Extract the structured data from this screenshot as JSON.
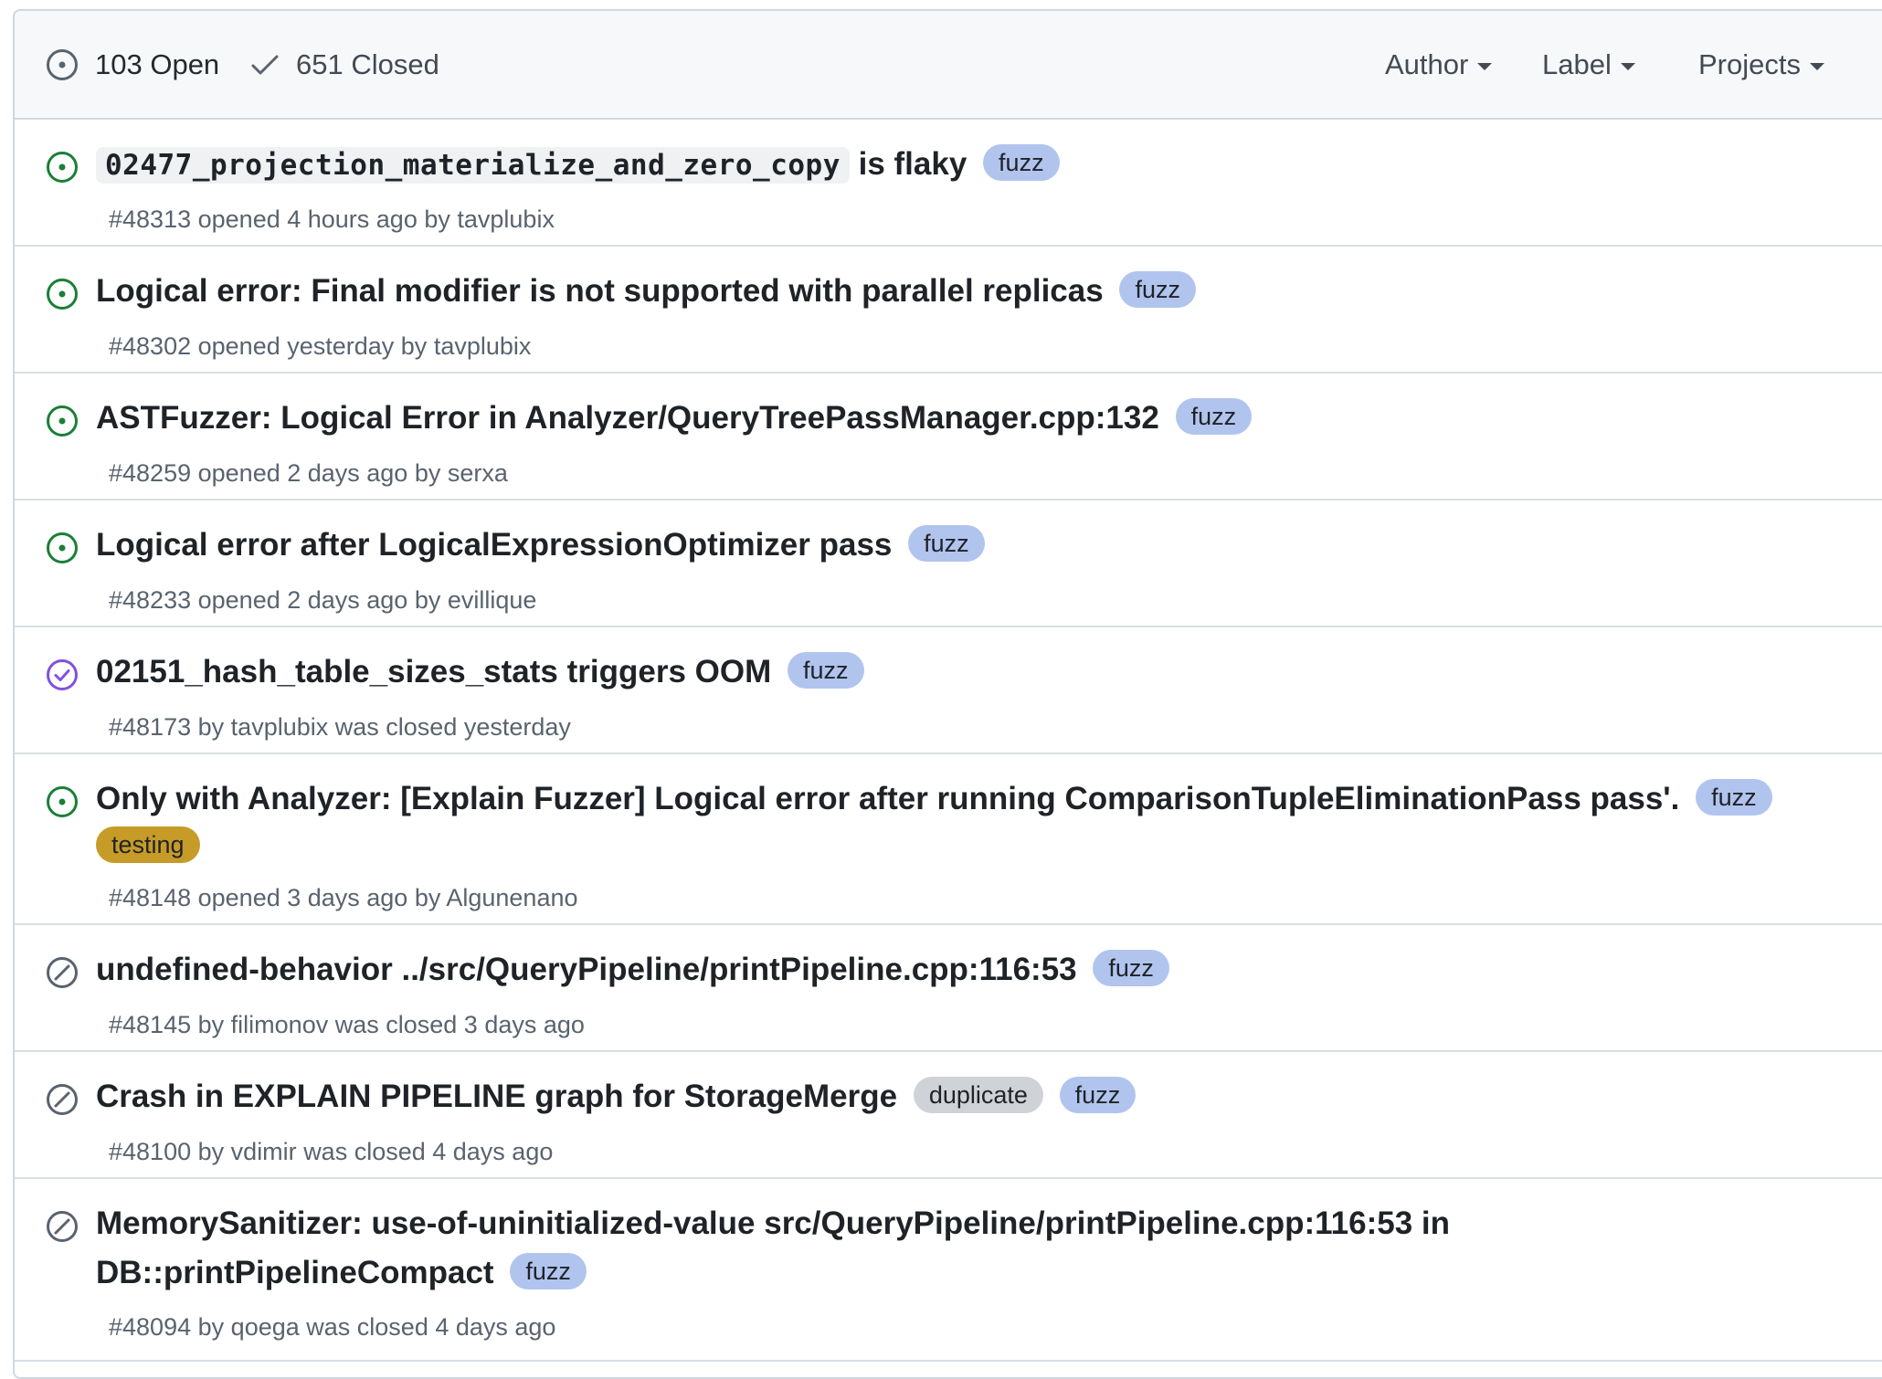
{
  "header": {
    "open_count": "103 Open",
    "closed_count": "651 Closed",
    "filters": {
      "author": "Author",
      "label": "Label",
      "projects": "Projects"
    }
  },
  "colors": {
    "open_icon": "#1a7f37",
    "closed_completed_icon": "#8250df",
    "closed_not_planned_icon": "#59636e",
    "label_fuzz": "#b1c4ee",
    "label_testing": "#c69b28",
    "label_duplicate": "#cfd3d7"
  },
  "issues": [
    {
      "state": "open",
      "icon": "issue-opened-icon",
      "title_code": "02477_projection_materialize_and_zero_copy",
      "title_rest": "is flaky",
      "labels": [
        "fuzz"
      ],
      "number": "#48313",
      "meta": "opened 4 hours ago by",
      "author": "tavplubix"
    },
    {
      "state": "open",
      "icon": "issue-opened-icon",
      "title": "Logical error: Final modifier is not supported with parallel replicas",
      "labels": [
        "fuzz"
      ],
      "number": "#48302",
      "meta": "opened yesterday by",
      "author": "tavplubix"
    },
    {
      "state": "open",
      "icon": "issue-opened-icon",
      "title": "ASTFuzzer: Logical Error in Analyzer/QueryTreePassManager.cpp:132",
      "labels": [
        "fuzz"
      ],
      "number": "#48259",
      "meta": "opened 2 days ago by",
      "author": "serxa"
    },
    {
      "state": "open",
      "icon": "issue-opened-icon",
      "title": "Logical error after LogicalExpressionOptimizer pass",
      "labels": [
        "fuzz"
      ],
      "number": "#48233",
      "meta": "opened 2 days ago by",
      "author": "evillique"
    },
    {
      "state": "closed-completed",
      "icon": "issue-closed-icon",
      "title": "02151_hash_table_sizes_stats triggers OOM",
      "labels": [
        "fuzz"
      ],
      "number": "#48173",
      "meta_prefix": "by",
      "author": "tavplubix",
      "meta_suffix": "was closed yesterday"
    },
    {
      "state": "open",
      "icon": "issue-opened-icon",
      "title": "Only with Analyzer: [Explain Fuzzer] Logical error after running ComparisonTupleEliminationPass pass'.",
      "labels": [
        "fuzz",
        "testing"
      ],
      "number": "#48148",
      "meta": "opened 3 days ago by",
      "author": "Algunenano"
    },
    {
      "state": "closed-not-planned",
      "icon": "skip-icon",
      "title": "undefined-behavior ../src/QueryPipeline/printPipeline.cpp:116:53",
      "labels": [
        "fuzz"
      ],
      "number": "#48145",
      "meta_prefix": "by",
      "author": "filimonov",
      "meta_suffix": "was closed 3 days ago"
    },
    {
      "state": "closed-not-planned",
      "icon": "skip-icon",
      "title": "Crash in EXPLAIN PIPELINE graph for StorageMerge",
      "labels": [
        "duplicate",
        "fuzz"
      ],
      "number": "#48100",
      "meta_prefix": "by",
      "author": "vdimir",
      "meta_suffix": "was closed 4 days ago"
    },
    {
      "state": "closed-not-planned",
      "icon": "skip-icon",
      "title_line1": "MemorySanitizer: use-of-uninitialized-value src/QueryPipeline/printPipeline.cpp:116:53 in",
      "title_line2": "DB::printPipelineCompact",
      "labels": [
        "fuzz"
      ],
      "number": "#48094",
      "meta_prefix": "by",
      "author": "qoega",
      "meta_suffix": "was closed 4 days ago"
    }
  ]
}
